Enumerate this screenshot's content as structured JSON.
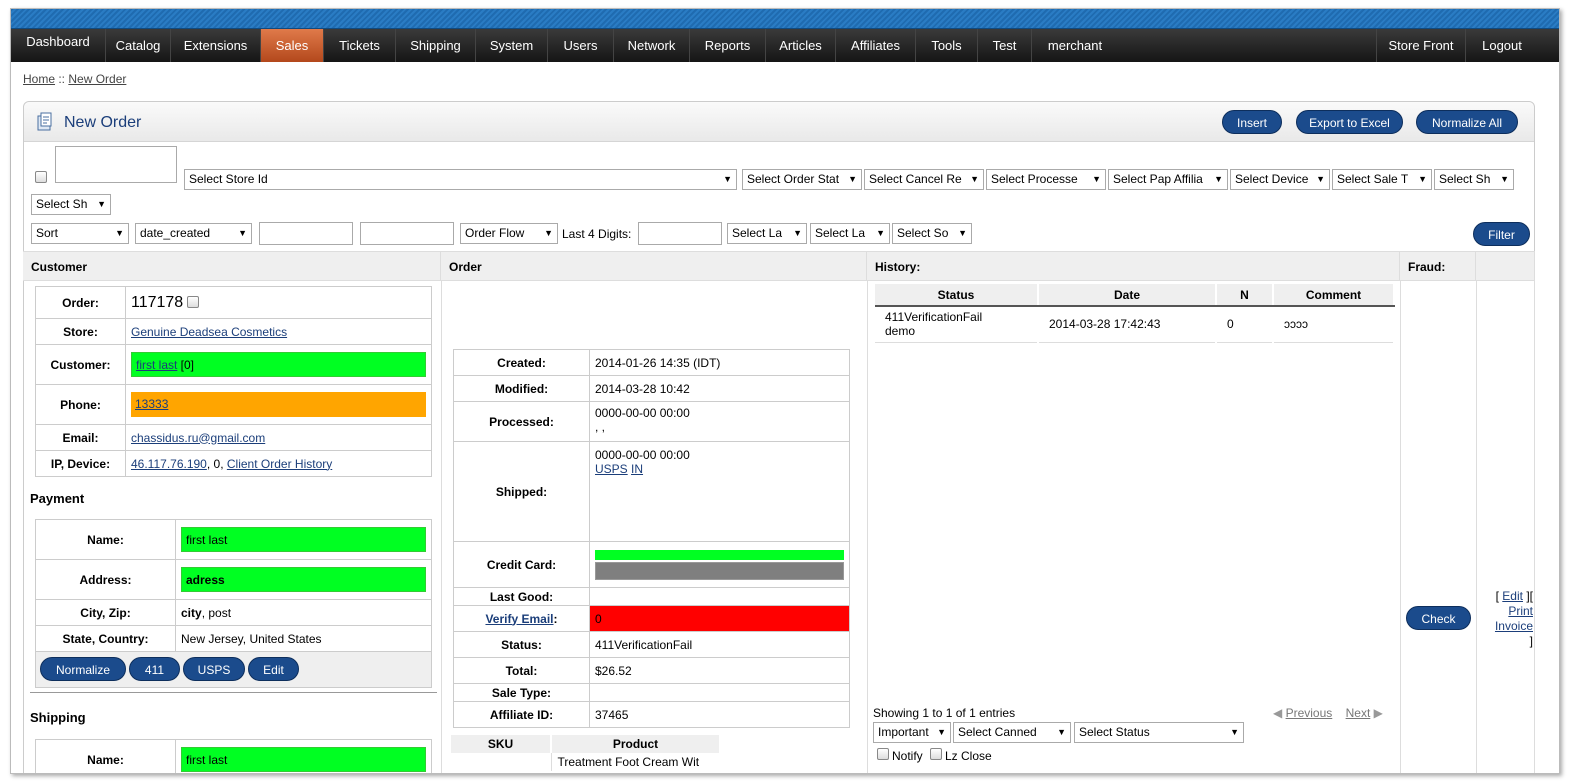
{
  "nav": {
    "items": [
      "Dashboard",
      "Catalog",
      "Extensions",
      "Sales",
      "Tickets",
      "Shipping",
      "System",
      "Users",
      "Network",
      "Reports",
      "Articles",
      "Affiliates",
      "Tools",
      "Test",
      "merchant"
    ],
    "active": "Sales",
    "right": [
      "Store Front",
      "Logout"
    ]
  },
  "breadcrumb": {
    "home": "Home",
    "sep": " :: ",
    "current": "New Order"
  },
  "header": {
    "title": "New Order",
    "insert": "Insert",
    "export": "Export to Excel",
    "normalize_all": "Normalize All"
  },
  "filters": {
    "store": "Select Store Id",
    "order_status": "Select Order Stat",
    "cancel_reason": "Select Cancel Re",
    "processed": "Select Processe",
    "pap_affiliate": "Select Pap Affilia",
    "device": "Select Device",
    "sale_type": "Select Sale T",
    "ship1": "Select Sh",
    "ship2": "Select Sh",
    "sort": "Sort",
    "sort_field": "date_created",
    "order_flow": "Order Flow",
    "last4_label": "Last 4 Digits:",
    "la1": "Select La",
    "la2": "Select La",
    "so": "Select So",
    "filter_btn": "Filter"
  },
  "columns": {
    "customer": "Customer",
    "order": "Order",
    "history": "History:",
    "fraud": "Fraud:"
  },
  "customer": {
    "order_label": "Order:",
    "order_id": "117178",
    "store_label": "Store:",
    "store": "Genuine Deadsea Cosmetics",
    "customer_label": "Customer:",
    "customer_name": "first last",
    "customer_count": " [0]",
    "phone_label": "Phone:",
    "phone": "13333",
    "email_label": "Email:",
    "email": "chassidus.ru@gmail.com",
    "ip_label": "IP, Device:",
    "ip": "46.117.76.190",
    "device": ", 0, ",
    "history_link": "Client Order History"
  },
  "payment": {
    "title": "Payment",
    "name_label": "Name:",
    "name": "first last",
    "address_label": "Address:",
    "address": "adress",
    "city_label": "City, Zip:",
    "city": "city",
    "zip": ", post",
    "state_label": "State, Country:",
    "state": "New Jersey, United States",
    "buttons": [
      "Normalize",
      "411",
      "USPS",
      "Edit"
    ]
  },
  "shipping": {
    "title": "Shipping",
    "name_label": "Name:",
    "name": "first last"
  },
  "order": {
    "created_label": "Created:",
    "created": "2014-01-26 14:35 (IDT)",
    "modified_label": "Modified:",
    "modified": "2014-03-28 10:42",
    "processed_label": "Processed:",
    "processed": "0000-00-00 00:00",
    "processed2": ", ,",
    "shipped_label": "Shipped:",
    "shipped": "0000-00-00 00:00",
    "ship_link1": "USPS",
    "ship_link2": "IN",
    "cc_label": "Credit Card:",
    "last_good_label": "Last Good:",
    "verify_label": "Verify Email",
    "verify_colon": ":",
    "verify_value": "0",
    "status_label": "Status:",
    "status": "411VerificationFail",
    "total_label": "Total:",
    "total": "$26.52",
    "sale_type_label": "Sale Type:",
    "affiliate_label": "Affiliate ID:",
    "affiliate": "37465",
    "sku_header": "SKU",
    "product_header": "Product",
    "product": "Treatment Foot Cream Wit"
  },
  "history": {
    "headers": [
      "Status",
      "Date",
      "N",
      "Comment"
    ],
    "row": {
      "status1": "411VerificationFail",
      "status2": "demo",
      "date": "2014-03-28 17:42:43",
      "n": "0",
      "comment": "ɔɔɔɔ"
    },
    "showing": "Showing 1 to 1 of 1 entries",
    "previous": "Previous",
    "next": "Next",
    "important": "Important",
    "canned": "Select Canned",
    "status_select": "Select Status",
    "notify": "Notify",
    "lz_close": "Lz Close"
  },
  "fraud": {
    "check": "Check"
  },
  "actions": {
    "open": "[ ",
    "edit": "Edit",
    "mid": " ][",
    "print": "Print",
    "invoice": "Invoice",
    "close": "]"
  },
  "colors": {
    "green": "#00ff22",
    "orange": "#ffa500",
    "red": "#ff0000",
    "navy": "#1b4b8c",
    "active_tab": "#d0602e"
  }
}
